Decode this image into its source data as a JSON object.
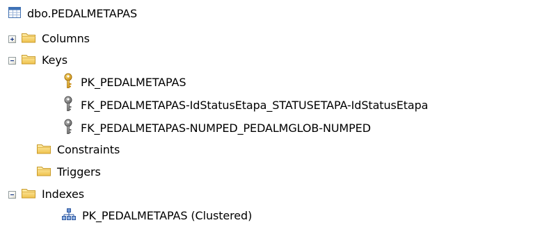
{
  "tree": {
    "root": {
      "label": "dbo.PEDALMETAPAS",
      "icon": "table-icon"
    },
    "folders": {
      "columns": {
        "label": "Columns",
        "state": "collapsed"
      },
      "keys": {
        "label": "Keys",
        "state": "expanded"
      },
      "constraints": {
        "label": "Constraints"
      },
      "triggers": {
        "label": "Triggers"
      },
      "indexes": {
        "label": "Indexes",
        "state": "expanded"
      }
    },
    "keys": [
      {
        "label": "PK_PEDALMETAPAS",
        "icon": "primary-key-icon"
      },
      {
        "label": "FK_PEDALMETAPAS-IdStatusEtapa_STATUSETAPA-IdStatusEtapa",
        "icon": "foreign-key-icon"
      },
      {
        "label": "FK_PEDALMETAPAS-NUMPED_PEDALMGLOB-NUMPED",
        "icon": "foreign-key-icon"
      }
    ],
    "indexes": [
      {
        "label": "PK_PEDALMETAPAS (Clustered)",
        "icon": "clustered-index-icon"
      }
    ]
  },
  "colors": {
    "folder_fill": "#f6d66c",
    "folder_edge": "#c89a2a",
    "primary_key": "#e8b020",
    "foreign_key": "#8e8e8e",
    "table_header": "#3f73b8",
    "expander_border": "#919b9c"
  }
}
